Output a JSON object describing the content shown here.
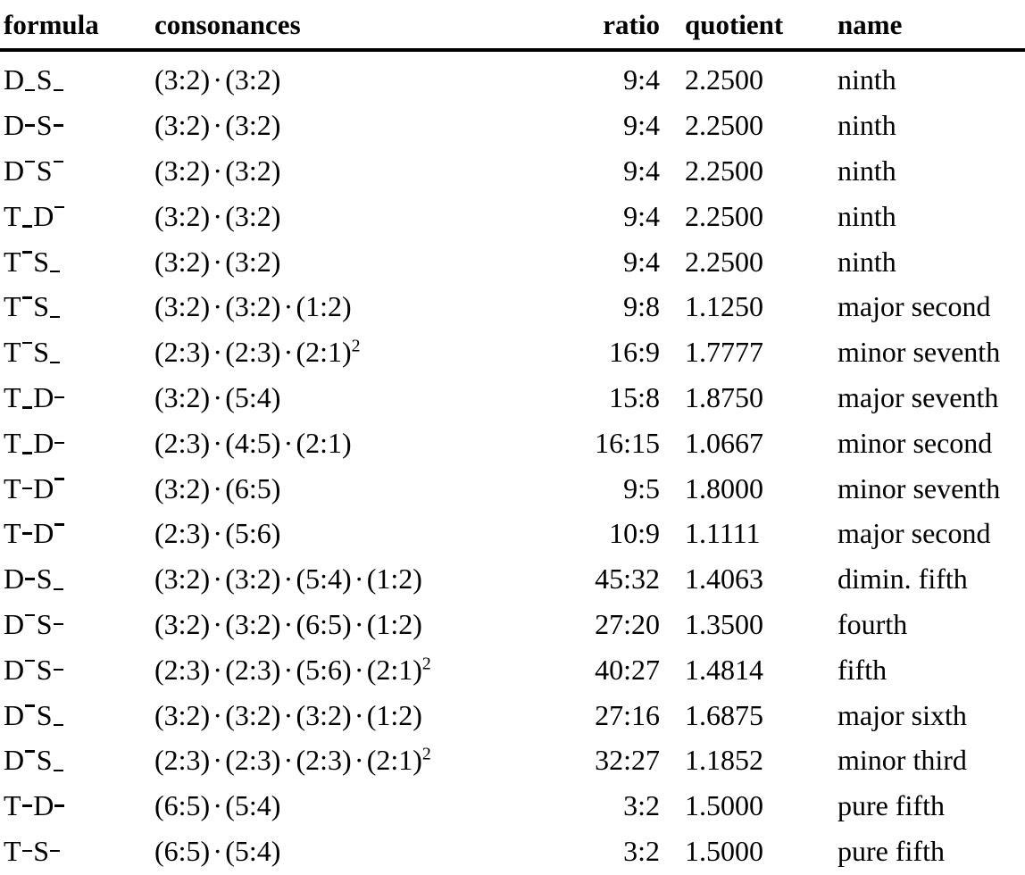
{
  "table": {
    "columns": [
      {
        "key": "formula",
        "label": "formula",
        "align": "left"
      },
      {
        "key": "consonances",
        "label": "consonances",
        "align": "left"
      },
      {
        "key": "ratio",
        "label": "ratio",
        "align": "right"
      },
      {
        "key": "quotient",
        "label": "quotient",
        "align": "left"
      },
      {
        "key": "name",
        "label": "name",
        "align": "left"
      }
    ],
    "marker_legend": {
      "sub": "subscript low bar",
      "mid": "mid-height dash",
      "sup": "superscript overline bar"
    },
    "rows": [
      {
        "formula_text": "D_S_",
        "formula_parts": [
          {
            "t": "D"
          },
          {
            "m": "sub"
          },
          {
            "t": "S"
          },
          {
            "m": "sub"
          }
        ],
        "consonances": "(3:2) · (3:2)",
        "consonance_factors": [
          "(3:2)",
          "(3:2)"
        ],
        "exponents": [
          null,
          null
        ],
        "ratio": "9:4",
        "quotient": "2.2500",
        "name": "ninth"
      },
      {
        "formula_text": "D-S-",
        "formula_parts": [
          {
            "t": "D"
          },
          {
            "m": "mid"
          },
          {
            "t": "S"
          },
          {
            "m": "mid"
          }
        ],
        "consonances": "(3:2) · (3:2)",
        "consonance_factors": [
          "(3:2)",
          "(3:2)"
        ],
        "exponents": [
          null,
          null
        ],
        "ratio": "9:4",
        "quotient": "2.2500",
        "name": "ninth"
      },
      {
        "formula_text": "D¯S¯",
        "formula_parts": [
          {
            "t": "D"
          },
          {
            "m": "sup"
          },
          {
            "t": "S"
          },
          {
            "m": "sup"
          }
        ],
        "consonances": "(3:2) · (3:2)",
        "consonance_factors": [
          "(3:2)",
          "(3:2)"
        ],
        "exponents": [
          null,
          null
        ],
        "ratio": "9:4",
        "quotient": "2.2500",
        "name": "ninth"
      },
      {
        "formula_text": "T_D¯",
        "formula_parts": [
          {
            "t": "T"
          },
          {
            "m": "sub"
          },
          {
            "t": "D"
          },
          {
            "m": "sup"
          }
        ],
        "consonances": "(3:2) · (3:2)",
        "consonance_factors": [
          "(3:2)",
          "(3:2)"
        ],
        "exponents": [
          null,
          null
        ],
        "ratio": "9:4",
        "quotient": "2.2500",
        "name": "ninth"
      },
      {
        "formula_text": "T¯S_",
        "formula_parts": [
          {
            "t": "T"
          },
          {
            "m": "sup"
          },
          {
            "t": "S"
          },
          {
            "m": "sub"
          }
        ],
        "consonances": "(3:2) · (3:2)",
        "consonance_factors": [
          "(3:2)",
          "(3:2)"
        ],
        "exponents": [
          null,
          null
        ],
        "ratio": "9:4",
        "quotient": "2.2500",
        "name": "ninth"
      },
      {
        "formula_text": "T¯S_",
        "formula_parts": [
          {
            "t": "T"
          },
          {
            "m": "sup"
          },
          {
            "t": "S"
          },
          {
            "m": "sub"
          }
        ],
        "consonances": "(3:2) · (3:2) · (1:2)",
        "consonance_factors": [
          "(3:2)",
          "(3:2)",
          "(1:2)"
        ],
        "exponents": [
          null,
          null,
          null
        ],
        "ratio": "9:8",
        "quotient": "1.1250",
        "name": "major second"
      },
      {
        "formula_text": "T¯S_",
        "formula_parts": [
          {
            "t": "T"
          },
          {
            "m": "sup"
          },
          {
            "t": "S"
          },
          {
            "m": "sub"
          }
        ],
        "consonances": "(2:3) · (2:3) · (2:1)²",
        "consonance_factors": [
          "(2:3)",
          "(2:3)",
          "(2:1)"
        ],
        "exponents": [
          null,
          null,
          "2"
        ],
        "ratio": "16:9",
        "quotient": "1.7777",
        "name": "minor seventh"
      },
      {
        "formula_text": "T_D-",
        "formula_parts": [
          {
            "t": "T"
          },
          {
            "m": "sub"
          },
          {
            "t": "D"
          },
          {
            "m": "mid"
          }
        ],
        "consonances": "(3:2) · (5:4)",
        "consonance_factors": [
          "(3:2)",
          "(5:4)"
        ],
        "exponents": [
          null,
          null
        ],
        "ratio": "15:8",
        "quotient": "1.8750",
        "name": "major seventh"
      },
      {
        "formula_text": "T_D-",
        "formula_parts": [
          {
            "t": "T"
          },
          {
            "m": "sub"
          },
          {
            "t": "D"
          },
          {
            "m": "mid"
          }
        ],
        "consonances": "(2:3) · (4:5) · (2:1)",
        "consonance_factors": [
          "(2:3)",
          "(4:5)",
          "(2:1)"
        ],
        "exponents": [
          null,
          null,
          null
        ],
        "ratio": "16:15",
        "quotient": "1.0667",
        "name": "minor second"
      },
      {
        "formula_text": "T-D¯",
        "formula_parts": [
          {
            "t": "T"
          },
          {
            "m": "mid"
          },
          {
            "t": "D"
          },
          {
            "m": "sup"
          }
        ],
        "consonances": "(3:2) · (6:5)",
        "consonance_factors": [
          "(3:2)",
          "(6:5)"
        ],
        "exponents": [
          null,
          null
        ],
        "ratio": "9:5",
        "quotient": "1.8000",
        "name": "minor seventh"
      },
      {
        "formula_text": "T-D¯",
        "formula_parts": [
          {
            "t": "T"
          },
          {
            "m": "mid"
          },
          {
            "t": "D"
          },
          {
            "m": "sup"
          }
        ],
        "consonances": "(2:3) · (5:6)",
        "consonance_factors": [
          "(2:3)",
          "(5:6)"
        ],
        "exponents": [
          null,
          null
        ],
        "ratio": "10:9",
        "quotient": "1.1111",
        "name": "major second"
      },
      {
        "formula_text": "D-S_",
        "formula_parts": [
          {
            "t": "D"
          },
          {
            "m": "mid"
          },
          {
            "t": "S"
          },
          {
            "m": "sub"
          }
        ],
        "consonances": "(3:2) · (3:2) · (5:4) · (1:2)",
        "consonance_factors": [
          "(3:2)",
          "(3:2)",
          "(5:4)",
          "(1:2)"
        ],
        "exponents": [
          null,
          null,
          null,
          null
        ],
        "ratio": "45:32",
        "quotient": "1.4063",
        "name": "dimin. fifth"
      },
      {
        "formula_text": "D¯S-",
        "formula_parts": [
          {
            "t": "D"
          },
          {
            "m": "sup"
          },
          {
            "t": "S"
          },
          {
            "m": "mid"
          }
        ],
        "consonances": "(3:2) · (3:2) · (6:5) · (1:2)",
        "consonance_factors": [
          "(3:2)",
          "(3:2)",
          "(6:5)",
          "(1:2)"
        ],
        "exponents": [
          null,
          null,
          null,
          null
        ],
        "ratio": "27:20",
        "quotient": "1.3500",
        "name": "fourth"
      },
      {
        "formula_text": "D¯S-",
        "formula_parts": [
          {
            "t": "D"
          },
          {
            "m": "sup"
          },
          {
            "t": "S"
          },
          {
            "m": "mid"
          }
        ],
        "consonances": "(2:3) · (2:3) · (5:6) · (2:1)²",
        "consonance_factors": [
          "(2:3)",
          "(2:3)",
          "(5:6)",
          "(2:1)"
        ],
        "exponents": [
          null,
          null,
          null,
          "2"
        ],
        "ratio": "40:27",
        "quotient": "1.4814",
        "name": "fifth"
      },
      {
        "formula_text": "D¯S_",
        "formula_parts": [
          {
            "t": "D"
          },
          {
            "m": "sup"
          },
          {
            "t": "S"
          },
          {
            "m": "sub"
          }
        ],
        "consonances": "(3:2) · (3:2) · (3:2) · (1:2)",
        "consonance_factors": [
          "(3:2)",
          "(3:2)",
          "(3:2)",
          "(1:2)"
        ],
        "exponents": [
          null,
          null,
          null,
          null
        ],
        "ratio": "27:16",
        "quotient": "1.6875",
        "name": "major sixth"
      },
      {
        "formula_text": "D¯S_",
        "formula_parts": [
          {
            "t": "D"
          },
          {
            "m": "sup"
          },
          {
            "t": "S"
          },
          {
            "m": "sub"
          }
        ],
        "consonances": "(2:3) · (2:3) · (2:3) · (2:1)²",
        "consonance_factors": [
          "(2:3)",
          "(2:3)",
          "(2:3)",
          "(2:1)"
        ],
        "exponents": [
          null,
          null,
          null,
          "2"
        ],
        "ratio": "32:27",
        "quotient": "1.1852",
        "name": "minor third"
      },
      {
        "formula_text": "T-D-",
        "formula_parts": [
          {
            "t": "T"
          },
          {
            "m": "mid"
          },
          {
            "t": "D"
          },
          {
            "m": "mid"
          }
        ],
        "consonances": "(6:5) · (5:4)",
        "consonance_factors": [
          "(6:5)",
          "(5:4)"
        ],
        "exponents": [
          null,
          null
        ],
        "ratio": "3:2",
        "quotient": "1.5000",
        "name": "pure fifth"
      },
      {
        "formula_text": "T-S-",
        "formula_parts": [
          {
            "t": "T"
          },
          {
            "m": "mid"
          },
          {
            "t": "S"
          },
          {
            "m": "mid"
          }
        ],
        "consonances": "(6:5) · (5:4)",
        "consonance_factors": [
          "(6:5)",
          "(5:4)"
        ],
        "exponents": [
          null,
          null
        ],
        "ratio": "3:2",
        "quotient": "1.5000",
        "name": "pure fifth"
      }
    ]
  }
}
